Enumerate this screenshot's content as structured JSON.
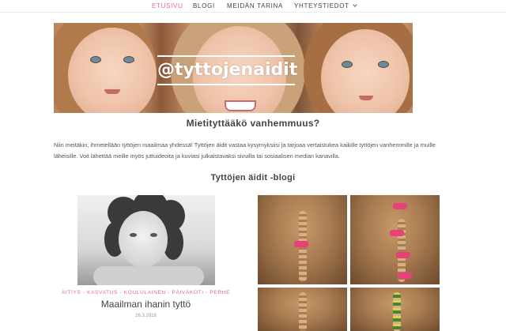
{
  "nav": {
    "items": [
      {
        "label": "ETUSIVU",
        "active": true
      },
      {
        "label": "BLOGI",
        "active": false
      },
      {
        "label": "MEIDÄN TARINA",
        "active": false
      },
      {
        "label": "YHTEYSTIEDOT",
        "active": false,
        "has_dropdown": true
      }
    ],
    "accent_color": "#e06b8f"
  },
  "hero": {
    "caption": "@tyttojenaidit"
  },
  "main": {
    "heading": "Mietityttääkö vanhemmuus?",
    "intro": "Niin meitäkin, ihmetellään tyttöjen maailmaa yhdessä! Tyttöjen äidit vastaa kysymyksiisi ja tarjoaa vertaistukea kaikille tyttöjen vanhemmille ja muille läheisille. Voit lähettää meille myös juttuideoita ja kuviasi julkaistavaksi sivuilla tai sosiaalisen median kanavilla.",
    "blog_heading": "Tyttöjen äidit -blogi"
  },
  "posts": [
    {
      "categories": "ÄITIYS - KASVATUS - KOULULAINEN - PÄIVÄKOTI - PERHE",
      "title": "Maailman ihanin tyttö",
      "date": "26.3.2018"
    }
  ]
}
